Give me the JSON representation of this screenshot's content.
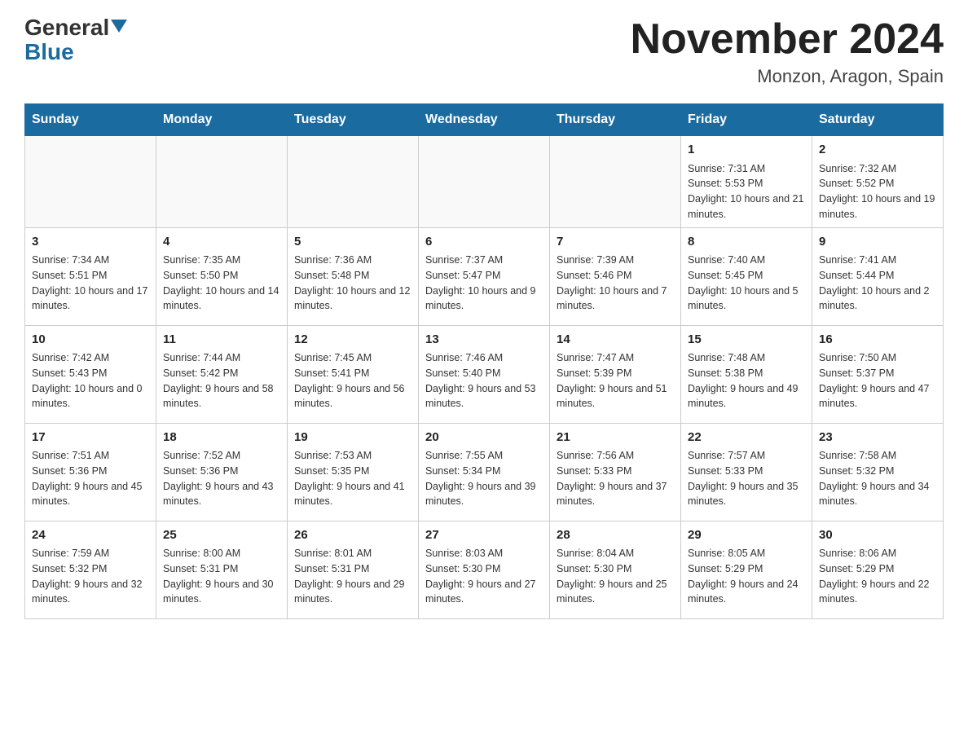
{
  "header": {
    "logo_top": "General",
    "logo_bottom": "Blue",
    "title": "November 2024",
    "subtitle": "Monzon, Aragon, Spain"
  },
  "days_of_week": [
    "Sunday",
    "Monday",
    "Tuesday",
    "Wednesday",
    "Thursday",
    "Friday",
    "Saturday"
  ],
  "weeks": [
    [
      {
        "day": "",
        "sunrise": "",
        "sunset": "",
        "daylight": ""
      },
      {
        "day": "",
        "sunrise": "",
        "sunset": "",
        "daylight": ""
      },
      {
        "day": "",
        "sunrise": "",
        "sunset": "",
        "daylight": ""
      },
      {
        "day": "",
        "sunrise": "",
        "sunset": "",
        "daylight": ""
      },
      {
        "day": "",
        "sunrise": "",
        "sunset": "",
        "daylight": ""
      },
      {
        "day": "1",
        "sunrise": "Sunrise: 7:31 AM",
        "sunset": "Sunset: 5:53 PM",
        "daylight": "Daylight: 10 hours and 21 minutes."
      },
      {
        "day": "2",
        "sunrise": "Sunrise: 7:32 AM",
        "sunset": "Sunset: 5:52 PM",
        "daylight": "Daylight: 10 hours and 19 minutes."
      }
    ],
    [
      {
        "day": "3",
        "sunrise": "Sunrise: 7:34 AM",
        "sunset": "Sunset: 5:51 PM",
        "daylight": "Daylight: 10 hours and 17 minutes."
      },
      {
        "day": "4",
        "sunrise": "Sunrise: 7:35 AM",
        "sunset": "Sunset: 5:50 PM",
        "daylight": "Daylight: 10 hours and 14 minutes."
      },
      {
        "day": "5",
        "sunrise": "Sunrise: 7:36 AM",
        "sunset": "Sunset: 5:48 PM",
        "daylight": "Daylight: 10 hours and 12 minutes."
      },
      {
        "day": "6",
        "sunrise": "Sunrise: 7:37 AM",
        "sunset": "Sunset: 5:47 PM",
        "daylight": "Daylight: 10 hours and 9 minutes."
      },
      {
        "day": "7",
        "sunrise": "Sunrise: 7:39 AM",
        "sunset": "Sunset: 5:46 PM",
        "daylight": "Daylight: 10 hours and 7 minutes."
      },
      {
        "day": "8",
        "sunrise": "Sunrise: 7:40 AM",
        "sunset": "Sunset: 5:45 PM",
        "daylight": "Daylight: 10 hours and 5 minutes."
      },
      {
        "day": "9",
        "sunrise": "Sunrise: 7:41 AM",
        "sunset": "Sunset: 5:44 PM",
        "daylight": "Daylight: 10 hours and 2 minutes."
      }
    ],
    [
      {
        "day": "10",
        "sunrise": "Sunrise: 7:42 AM",
        "sunset": "Sunset: 5:43 PM",
        "daylight": "Daylight: 10 hours and 0 minutes."
      },
      {
        "day": "11",
        "sunrise": "Sunrise: 7:44 AM",
        "sunset": "Sunset: 5:42 PM",
        "daylight": "Daylight: 9 hours and 58 minutes."
      },
      {
        "day": "12",
        "sunrise": "Sunrise: 7:45 AM",
        "sunset": "Sunset: 5:41 PM",
        "daylight": "Daylight: 9 hours and 56 minutes."
      },
      {
        "day": "13",
        "sunrise": "Sunrise: 7:46 AM",
        "sunset": "Sunset: 5:40 PM",
        "daylight": "Daylight: 9 hours and 53 minutes."
      },
      {
        "day": "14",
        "sunrise": "Sunrise: 7:47 AM",
        "sunset": "Sunset: 5:39 PM",
        "daylight": "Daylight: 9 hours and 51 minutes."
      },
      {
        "day": "15",
        "sunrise": "Sunrise: 7:48 AM",
        "sunset": "Sunset: 5:38 PM",
        "daylight": "Daylight: 9 hours and 49 minutes."
      },
      {
        "day": "16",
        "sunrise": "Sunrise: 7:50 AM",
        "sunset": "Sunset: 5:37 PM",
        "daylight": "Daylight: 9 hours and 47 minutes."
      }
    ],
    [
      {
        "day": "17",
        "sunrise": "Sunrise: 7:51 AM",
        "sunset": "Sunset: 5:36 PM",
        "daylight": "Daylight: 9 hours and 45 minutes."
      },
      {
        "day": "18",
        "sunrise": "Sunrise: 7:52 AM",
        "sunset": "Sunset: 5:36 PM",
        "daylight": "Daylight: 9 hours and 43 minutes."
      },
      {
        "day": "19",
        "sunrise": "Sunrise: 7:53 AM",
        "sunset": "Sunset: 5:35 PM",
        "daylight": "Daylight: 9 hours and 41 minutes."
      },
      {
        "day": "20",
        "sunrise": "Sunrise: 7:55 AM",
        "sunset": "Sunset: 5:34 PM",
        "daylight": "Daylight: 9 hours and 39 minutes."
      },
      {
        "day": "21",
        "sunrise": "Sunrise: 7:56 AM",
        "sunset": "Sunset: 5:33 PM",
        "daylight": "Daylight: 9 hours and 37 minutes."
      },
      {
        "day": "22",
        "sunrise": "Sunrise: 7:57 AM",
        "sunset": "Sunset: 5:33 PM",
        "daylight": "Daylight: 9 hours and 35 minutes."
      },
      {
        "day": "23",
        "sunrise": "Sunrise: 7:58 AM",
        "sunset": "Sunset: 5:32 PM",
        "daylight": "Daylight: 9 hours and 34 minutes."
      }
    ],
    [
      {
        "day": "24",
        "sunrise": "Sunrise: 7:59 AM",
        "sunset": "Sunset: 5:32 PM",
        "daylight": "Daylight: 9 hours and 32 minutes."
      },
      {
        "day": "25",
        "sunrise": "Sunrise: 8:00 AM",
        "sunset": "Sunset: 5:31 PM",
        "daylight": "Daylight: 9 hours and 30 minutes."
      },
      {
        "day": "26",
        "sunrise": "Sunrise: 8:01 AM",
        "sunset": "Sunset: 5:31 PM",
        "daylight": "Daylight: 9 hours and 29 minutes."
      },
      {
        "day": "27",
        "sunrise": "Sunrise: 8:03 AM",
        "sunset": "Sunset: 5:30 PM",
        "daylight": "Daylight: 9 hours and 27 minutes."
      },
      {
        "day": "28",
        "sunrise": "Sunrise: 8:04 AM",
        "sunset": "Sunset: 5:30 PM",
        "daylight": "Daylight: 9 hours and 25 minutes."
      },
      {
        "day": "29",
        "sunrise": "Sunrise: 8:05 AM",
        "sunset": "Sunset: 5:29 PM",
        "daylight": "Daylight: 9 hours and 24 minutes."
      },
      {
        "day": "30",
        "sunrise": "Sunrise: 8:06 AM",
        "sunset": "Sunset: 5:29 PM",
        "daylight": "Daylight: 9 hours and 22 minutes."
      }
    ]
  ]
}
